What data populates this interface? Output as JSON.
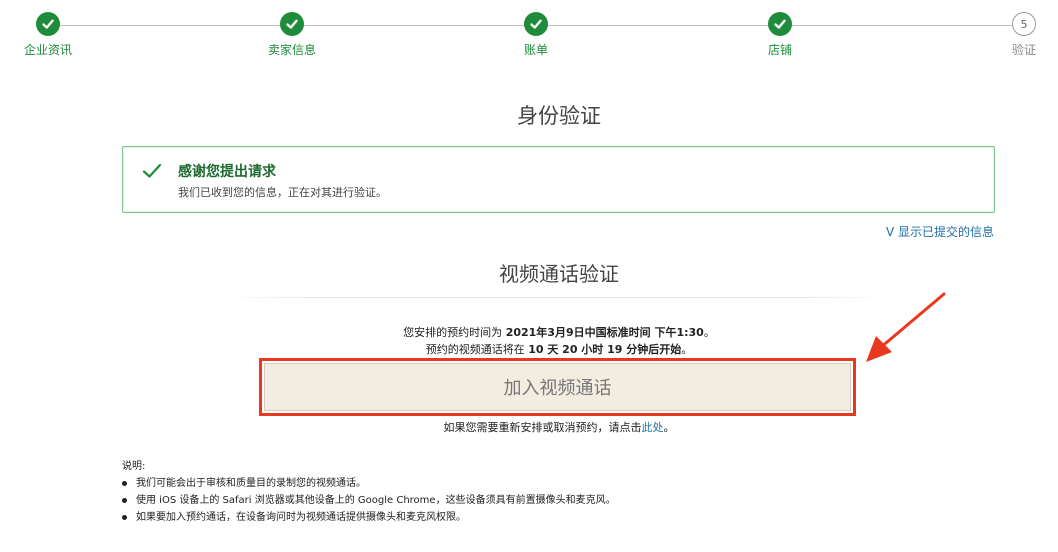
{
  "steps": [
    {
      "label": "企业资讯",
      "status": "done"
    },
    {
      "label": "卖家信息",
      "status": "done"
    },
    {
      "label": "账单",
      "status": "done"
    },
    {
      "label": "店铺",
      "status": "done"
    },
    {
      "label": "验证",
      "status": "pending",
      "number": "5"
    }
  ],
  "page_title": "身份验证",
  "alert": {
    "title": "感谢您提出请求",
    "message": "我们已收到您的信息，正在对其进行验证。"
  },
  "show_info_link": "V 显示已提交的信息",
  "video_section": {
    "title": "视频通话验证",
    "schedule_prefix": "您安排的预约时间为 ",
    "schedule_time": "2021年3月9日中国标准时间 下午1:30",
    "schedule_suffix": "。",
    "countdown_prefix": "预约的视频通话将在 ",
    "countdown_value": "10 天 20 小时 19 分钟后开始",
    "countdown_suffix": "。",
    "join_button": "加入视频通话",
    "reschedule_prefix": "如果您需要重新安排或取消预约，请点击",
    "reschedule_link": "此处",
    "reschedule_suffix": "。"
  },
  "notes": {
    "heading": "说明:",
    "items": [
      "我们可能会出于审核和质量目的录制您的视频通话。",
      "使用 iOS 设备上的 Safari 浏览器或其他设备上的 Google Chrome，这些设备须具有前置摄像头和麦克风。",
      "如果要加入预约通话，在设备询问时为视频通话提供摄像头和麦克风权限。"
    ]
  },
  "colors": {
    "success_green": "#1e8c3a",
    "link_blue": "#1f6fa8",
    "highlight_red": "#e8381e",
    "button_bg": "#f3ece0"
  }
}
